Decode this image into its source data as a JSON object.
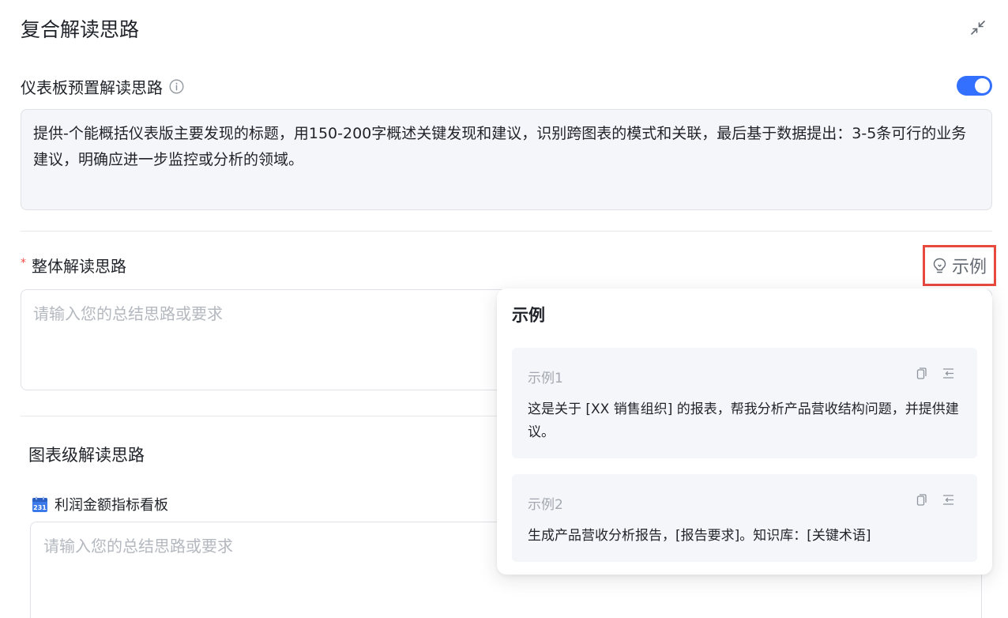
{
  "page": {
    "title": "复合解读思路"
  },
  "preset": {
    "label": "仪表板预置解读思路",
    "enabled": true,
    "text": "提供-个能概括仪表版主要发现的标题，用150-200字概述关键发现和建议，识别跨图表的模式和关联，最后基于数据提出：3-5条可行的业务建议，明确应进一步监控或分析的领域。"
  },
  "overall": {
    "required_mark": "*",
    "label": "整体解读思路",
    "placeholder": "请输入您的总结思路或要求",
    "example_button_label": "示例"
  },
  "chart_level": {
    "label": "图表级解读思路",
    "items": [
      {
        "icon_text": "231",
        "name": "利润金额指标看板",
        "placeholder": "请输入您的总结思路或要求"
      }
    ]
  },
  "examples_popover": {
    "title": "示例",
    "examples": [
      {
        "name": "示例1",
        "text": "这是关于 [XX 销售组织] 的报表，帮我分析产品营收结构问题，并提供建议。"
      },
      {
        "name": "示例2",
        "text": "生成产品营收分析报告，[报告要求]。知识库：[关键术语]"
      }
    ]
  },
  "colors": {
    "accent": "#3370ff",
    "highlight_border": "#e8493f",
    "required": "#f54a45"
  }
}
